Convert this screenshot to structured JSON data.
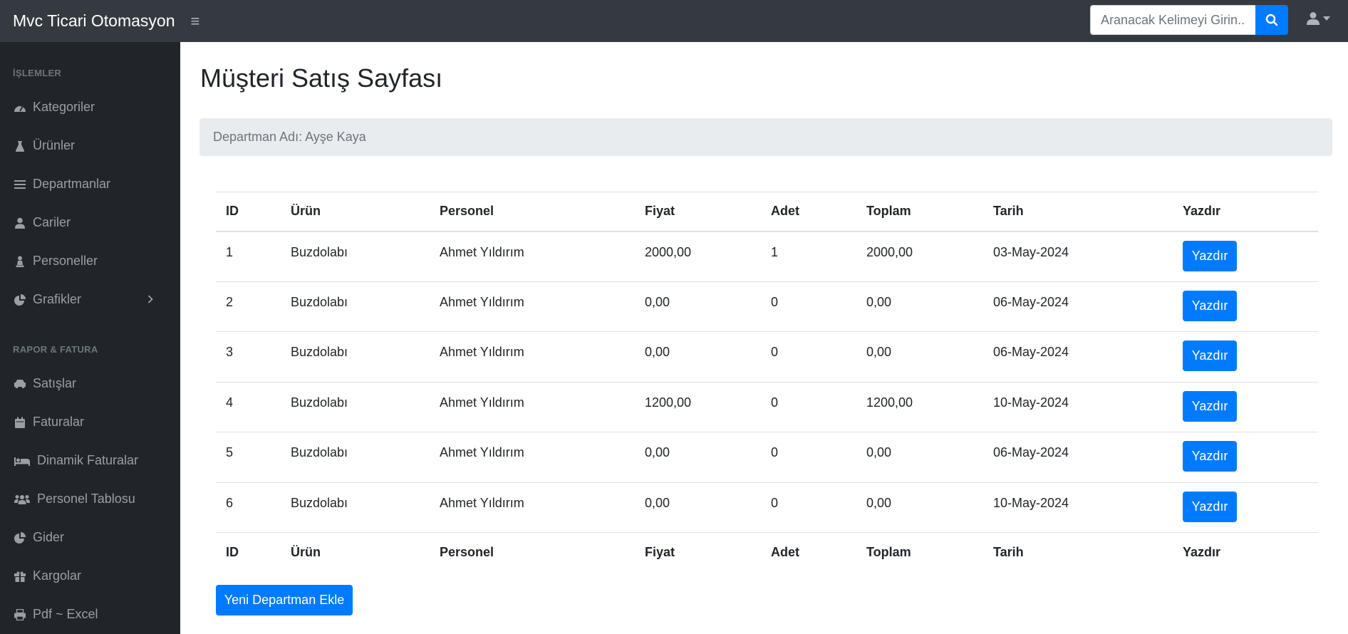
{
  "app": {
    "brand": "Mvc Ticari Otomasyon"
  },
  "search": {
    "placeholder": "Aranacak Kelimeyi Girin..."
  },
  "sidebar": {
    "sections": [
      {
        "heading": "İŞLEMLER"
      },
      {
        "heading": "RAPOR & FATURA"
      }
    ],
    "items": [
      {
        "label": "Kategoriler",
        "icon": "tachometer-icon"
      },
      {
        "label": "Ürünler",
        "icon": "flask-icon"
      },
      {
        "label": "Departmanlar",
        "icon": "list-icon"
      },
      {
        "label": "Cariler",
        "icon": "user-icon"
      },
      {
        "label": "Personeller",
        "icon": "chess-pawn-icon"
      },
      {
        "label": "Grafikler",
        "icon": "pie-chart-icon"
      },
      {
        "label": "Satışlar",
        "icon": "car-icon"
      },
      {
        "label": "Faturalar",
        "icon": "calendar-icon"
      },
      {
        "label": "Dinamik Faturalar",
        "icon": "bed-icon"
      },
      {
        "label": "Personel Tablosu",
        "icon": "users-icon"
      },
      {
        "label": "Gider",
        "icon": "pie-chart-icon"
      },
      {
        "label": "Kargolar",
        "icon": "gift-icon"
      },
      {
        "label": "Pdf ~ Excel",
        "icon": "print-icon"
      }
    ]
  },
  "page": {
    "title": "Müşteri Satış Sayfası",
    "breadcrumb": "Departman Adı: Ayşe Kaya"
  },
  "table": {
    "columns": [
      "ID",
      "Ürün",
      "Personel",
      "Fiyat",
      "Adet",
      "Toplam",
      "Tarih",
      "Yazdır"
    ],
    "rows": [
      {
        "id": "1",
        "urun": "Buzdolabı",
        "personel": "Ahmet Yıldırım",
        "fiyat": "2000,00",
        "adet": "1",
        "toplam": "2000,00",
        "tarih": "03-May-2024",
        "button": "Yazdır"
      },
      {
        "id": "2",
        "urun": "Buzdolabı",
        "personel": "Ahmet Yıldırım",
        "fiyat": "0,00",
        "adet": "0",
        "toplam": "0,00",
        "tarih": "06-May-2024",
        "button": "Yazdır"
      },
      {
        "id": "3",
        "urun": "Buzdolabı",
        "personel": "Ahmet Yıldırım",
        "fiyat": "0,00",
        "adet": "0",
        "toplam": "0,00",
        "tarih": "06-May-2024",
        "button": "Yazdır"
      },
      {
        "id": "4",
        "urun": "Buzdolabı",
        "personel": "Ahmet Yıldırım",
        "fiyat": "1200,00",
        "adet": "0",
        "toplam": "1200,00",
        "tarih": "10-May-2024",
        "button": "Yazdır"
      },
      {
        "id": "5",
        "urun": "Buzdolabı",
        "personel": "Ahmet Yıldırım",
        "fiyat": "0,00",
        "adet": "0",
        "toplam": "0,00",
        "tarih": "06-May-2024",
        "button": "Yazdır"
      },
      {
        "id": "6",
        "urun": "Buzdolabı",
        "personel": "Ahmet Yıldırım",
        "fiyat": "0,00",
        "adet": "0",
        "toplam": "0,00",
        "tarih": "10-May-2024",
        "button": "Yazdır"
      }
    ]
  },
  "actions": {
    "new_button": "Yeni Departman Ekle"
  },
  "colors": {
    "topbar": "#343a40",
    "sidebar": "#212529",
    "primary": "#007bff",
    "breadcrumb_bg": "#e9ecef"
  }
}
